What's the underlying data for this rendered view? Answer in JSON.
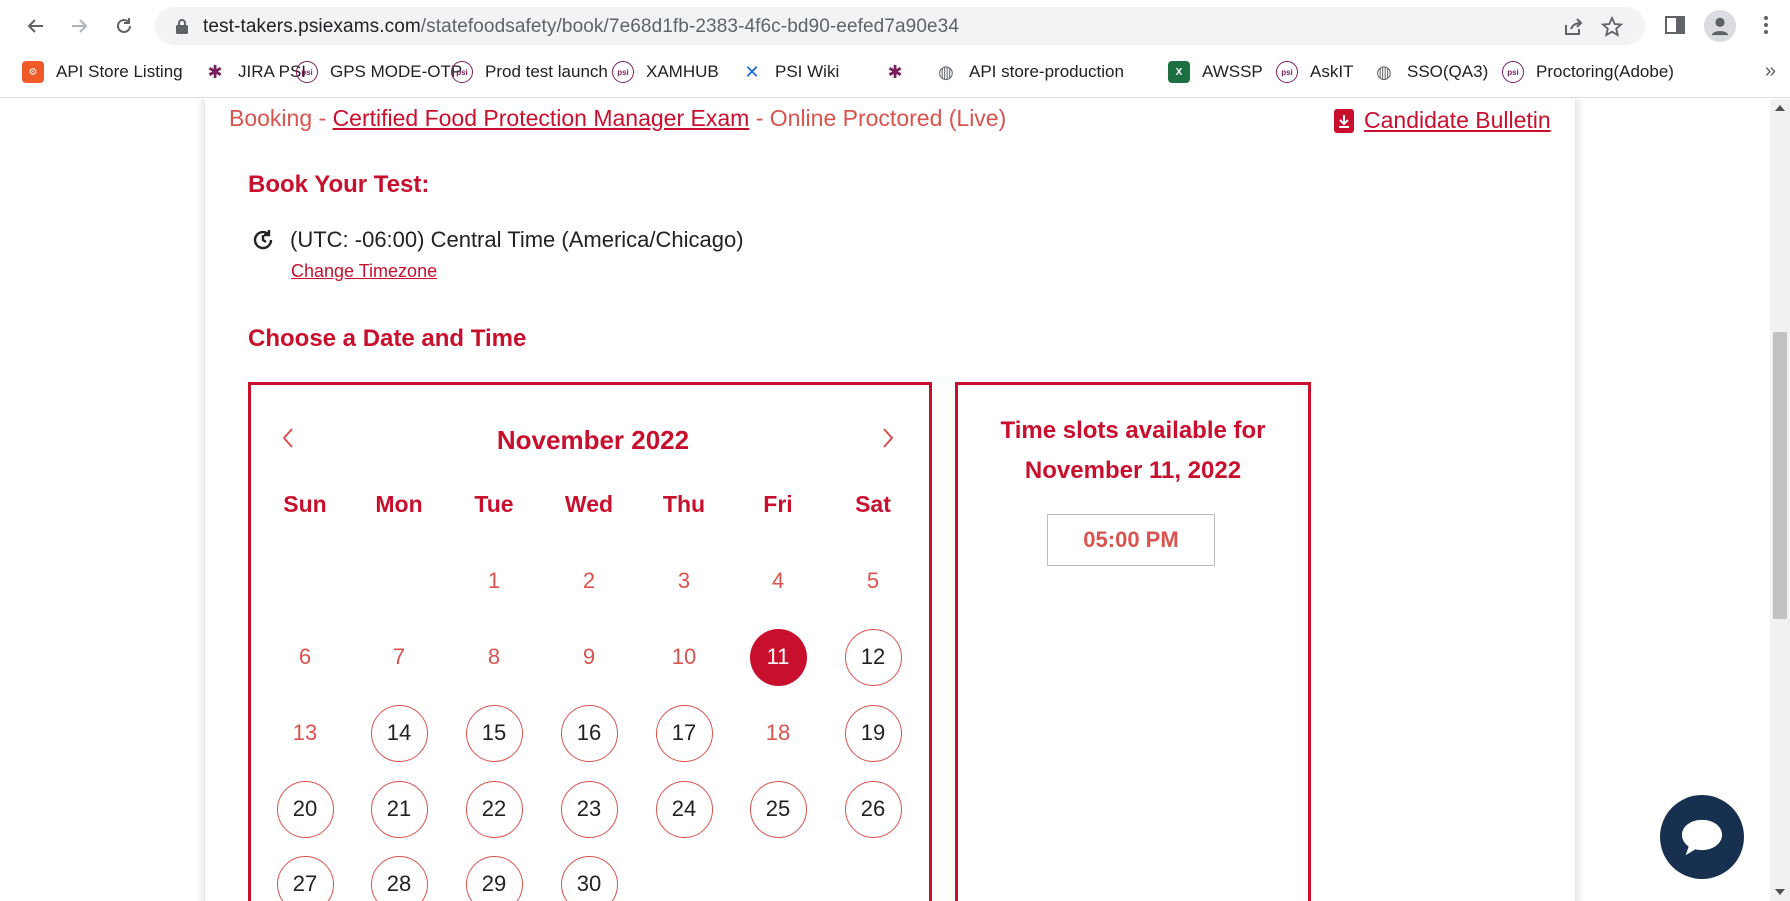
{
  "browser": {
    "url_host": "test-takers.psiexams.com",
    "url_path": "/statefoodsafety/book/7e68d1fb-2383-4f6c-bd90-eefed7a90e34",
    "bookmarks": [
      {
        "label": "API Store Listing",
        "icon": "api-store-icon",
        "color": "#f05a28"
      },
      {
        "label": "JIRA PSI",
        "icon": "jira-icon",
        "color": "#7a1f5c"
      },
      {
        "label": "GPS MODE-OTP",
        "icon": "psi-icon",
        "color": "#7a1f5c"
      },
      {
        "label": "Prod test launch",
        "icon": "psi-icon",
        "color": "#7a1f5c"
      },
      {
        "label": "XAMHUB",
        "icon": "psi-icon",
        "color": "#7a1f5c"
      },
      {
        "label": "PSI Wiki",
        "icon": "confluence-icon",
        "color": "#1868db"
      },
      {
        "label": "",
        "icon": "jira-icon",
        "color": "#7a1f5c"
      },
      {
        "label": "API store-production",
        "icon": "globe-icon",
        "color": "#5f6368"
      },
      {
        "label": "AWSSP",
        "icon": "excel-icon",
        "color": "#1d6f42"
      },
      {
        "label": "AskIT",
        "icon": "psi-icon",
        "color": "#7a1f5c"
      },
      {
        "label": "SSO(QA3)",
        "icon": "globe-icon",
        "color": "#5f6368"
      },
      {
        "label": "Proctoring(Adobe)",
        "icon": "psi-icon",
        "color": "#7a1f5c"
      }
    ],
    "more": "»"
  },
  "breadcrumb": {
    "prefix": "Booking - ",
    "link": "Certified Food Protection Manager Exam",
    "suffix": " - Online Proctored (Live)"
  },
  "bulletin_label": "Candidate Bulletin",
  "book_heading": "Book Your Test:",
  "timezone": "(UTC: -06:00) Central Time (America/Chicago)",
  "change_timezone": "Change Timezone",
  "choose_heading": "Choose a Date and Time",
  "calendar": {
    "month_label": "November 2022",
    "weekdays": [
      "Sun",
      "Mon",
      "Tue",
      "Wed",
      "Thu",
      "Fri",
      "Sat"
    ],
    "first_weekday_index": 2,
    "days_visible": 30,
    "selected_day": 11,
    "available_days": [
      12,
      14,
      15,
      16,
      17,
      19,
      20,
      21,
      22,
      23,
      24,
      25,
      26,
      27,
      28,
      29,
      30
    ]
  },
  "slots": {
    "title_line1": "Time slots available for",
    "title_line2": "November 11, 2022",
    "times": [
      "05:00 PM"
    ]
  },
  "colors": {
    "accent": "#c8102e",
    "muted_accent": "#d9534f",
    "chat": "#17304f"
  }
}
